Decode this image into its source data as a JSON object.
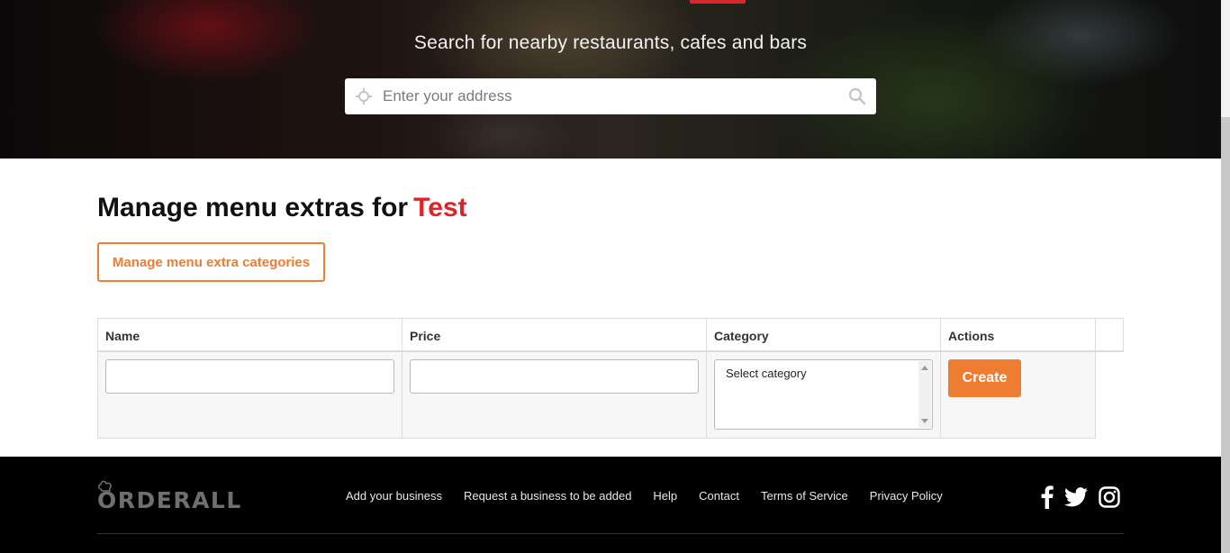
{
  "hero": {
    "title": "Search for nearby restaurants, cafes and bars",
    "search": {
      "placeholder": "Enter your address",
      "value": ""
    }
  },
  "main": {
    "title_prefix": "Manage menu extras for",
    "restaurant_name": "Test",
    "manage_categories_label": "Manage menu extra categories",
    "table": {
      "headers": [
        "Name",
        "Price",
        "Category",
        "Actions"
      ],
      "new_row": {
        "name_value": "",
        "price_value": "",
        "category_options": [
          "Select category"
        ],
        "create_label": "Create"
      }
    }
  },
  "footer": {
    "logo_text": "ORDERALL",
    "links": [
      "Add your business",
      "Request a business to be added",
      "Help",
      "Contact",
      "Terms of Service",
      "Privacy Policy"
    ],
    "social": [
      "facebook-icon",
      "twitter-icon",
      "instagram-icon"
    ]
  },
  "colors": {
    "accent_orange": "#ef7d31",
    "accent_red": "#d9262b",
    "footer_bg": "#000000"
  }
}
